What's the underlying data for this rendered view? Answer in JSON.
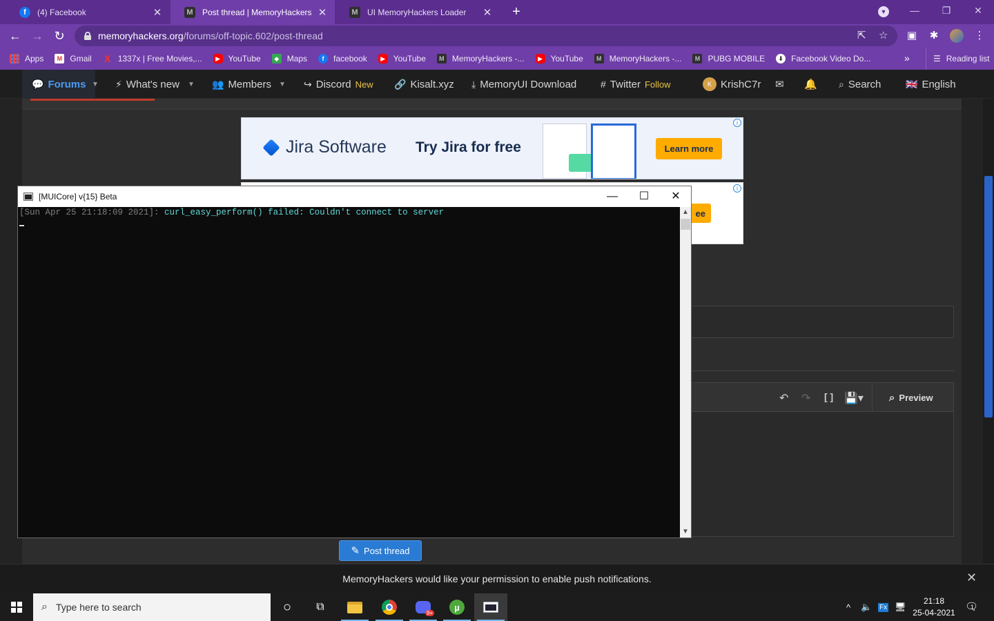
{
  "browser": {
    "tabs": [
      {
        "title": "(4) Facebook",
        "icon": "facebook-icon",
        "active": false
      },
      {
        "title": "Post thread | MemoryHackers",
        "icon": "memoryhackers-icon",
        "active": true
      },
      {
        "title": "UI MemoryHackers Loader",
        "icon": "memoryhackers-icon",
        "active": false
      }
    ],
    "url_host": "memoryhackers.org",
    "url_path": "/forums/off-topic.602/post-thread",
    "bookmarks": [
      {
        "label": "Apps",
        "icon": "apps-icon",
        "glyph": ""
      },
      {
        "label": "Gmail",
        "icon": "gmail-icon",
        "glyph": "M"
      },
      {
        "label": "1337x | Free Movies,...",
        "icon": "1337x-icon",
        "glyph": "X"
      },
      {
        "label": "YouTube",
        "icon": "youtube-icon",
        "glyph": "▶"
      },
      {
        "label": "Maps",
        "icon": "maps-icon",
        "glyph": "◆"
      },
      {
        "label": "facebook",
        "icon": "facebook-icon",
        "glyph": "f"
      },
      {
        "label": "YouTube",
        "icon": "youtube-icon",
        "glyph": "▶"
      },
      {
        "label": "MemoryHackers -...",
        "icon": "memoryhackers-icon",
        "glyph": "M"
      },
      {
        "label": "YouTube",
        "icon": "youtube-icon",
        "glyph": "▶"
      },
      {
        "label": "MemoryHackers -...",
        "icon": "memoryhackers-icon",
        "glyph": "M"
      },
      {
        "label": "PUBG MOBILE",
        "icon": "memoryhackers-icon",
        "glyph": "M"
      },
      {
        "label": "Facebook Video Do...",
        "icon": "facebook-video-downloader-icon",
        "glyph": "⬇"
      }
    ],
    "reading_list": "Reading list"
  },
  "sitenav": {
    "forums": "Forums",
    "whats_new": "What's new",
    "members": "Members",
    "discord": "Discord",
    "discord_badge": "New",
    "kisalt": "Kisalt.xyz",
    "memoryui": "MemoryUI Download",
    "twitter": "Twitter",
    "twitter_badge": "Follow",
    "user_initial": "K",
    "username": "KrishC7r",
    "search": "Search",
    "language": "English"
  },
  "ads": {
    "brand": "Jira Software",
    "tagline": "Try Jira for free",
    "cta": "Learn more",
    "second_cta_fragment": "ee"
  },
  "editor": {
    "preview_label": "Preview"
  },
  "post_button": "Post thread",
  "push_notice": "MemoryHackers would like your permission to enable push notifications.",
  "console": {
    "title": "[MUICore] v{15} Beta",
    "timestamp": "[Sun Apr 25 21:18:09 2021]: ",
    "message": "curl_easy_perform() failed: Couldn't connect to server"
  },
  "taskbar": {
    "search_placeholder": "Type here to search",
    "discord_badge": "9+",
    "time": "21:18",
    "date": "25-04-2021",
    "notification_count": "1"
  },
  "colors": {
    "chrome_frame": "#5a2d8f",
    "chrome_toolbar": "#6f3ea8",
    "site_accent": "#4d9bf0",
    "post_button": "#2a7bd3",
    "console_text": "#61d6d6"
  }
}
